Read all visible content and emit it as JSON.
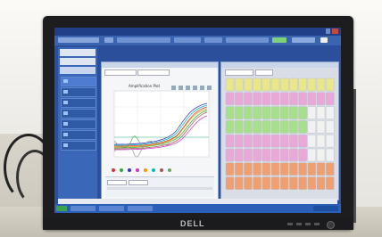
{
  "scene": {
    "monitor_brand": "DELL",
    "colors": {
      "bezel": "#1d1d1f",
      "app_blue": "#2b4f9a",
      "plate_yellow": "#e9e78a",
      "plate_pink": "#e9a8d8",
      "plate_green": "#a8e08a",
      "plate_orange": "#f0a070"
    },
    "icons": [
      "amplification-curve-icon",
      "well-plate-icon",
      "taskbar-start-icon"
    ]
  },
  "app": {
    "plot_title": "Amplification Plot"
  }
}
